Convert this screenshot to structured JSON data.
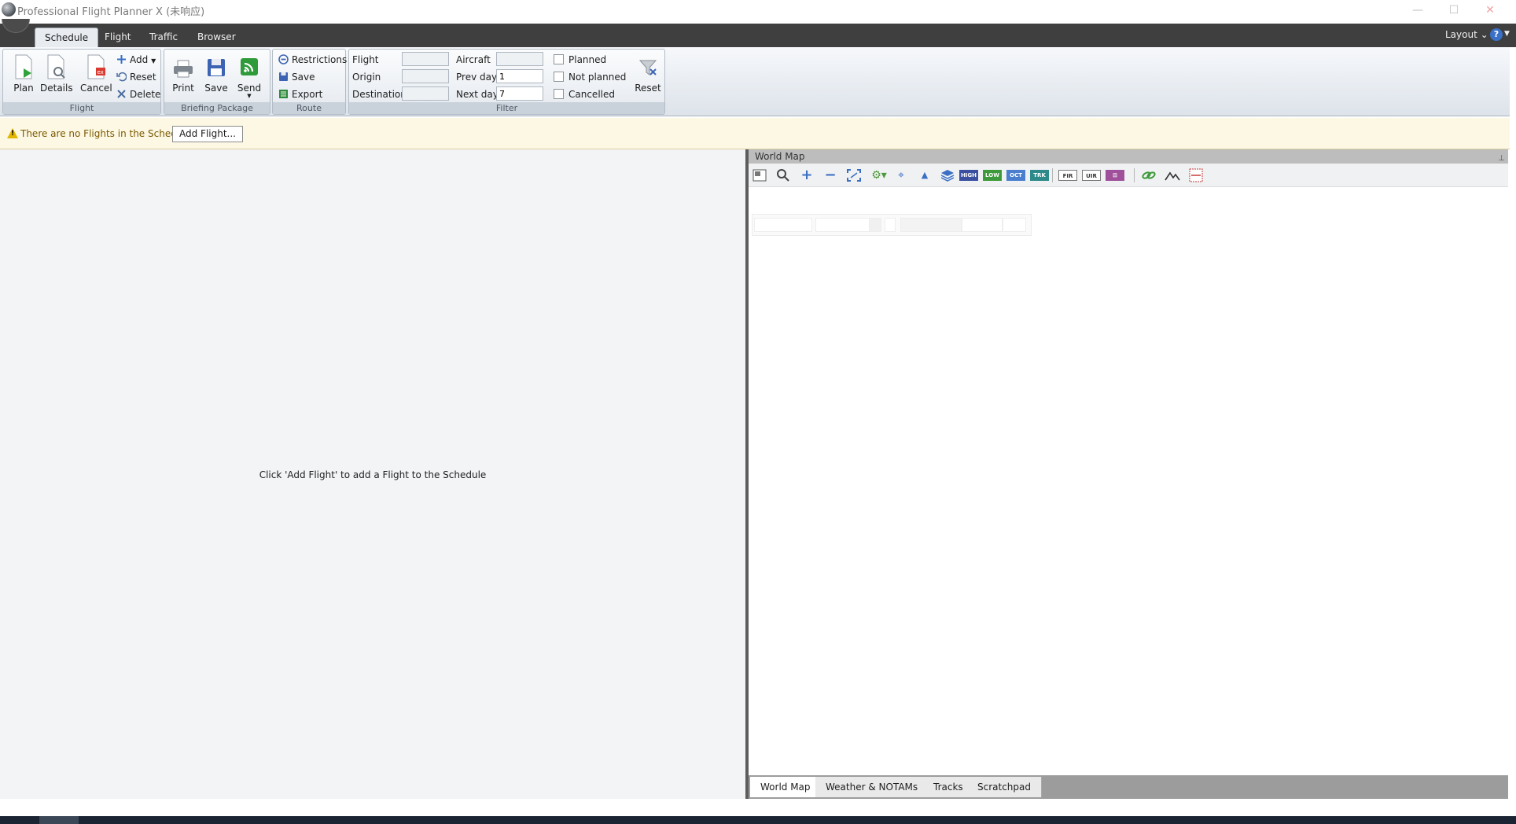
{
  "window": {
    "title": "Professional Flight Planner X (未响应)",
    "minimize": "—",
    "maximize": "☐",
    "close": "✕"
  },
  "ribbon_tabs": [
    "Schedule",
    "Flight",
    "Traffic",
    "Browser"
  ],
  "layout_menu": "Layout ⌄",
  "help": "?",
  "groups": {
    "flight": {
      "label": "Flight",
      "plan": "Plan",
      "details": "Details",
      "cancel": "Cancel",
      "add": "Add",
      "reset": "Reset",
      "delete": "Delete"
    },
    "briefing": {
      "label": "Briefing Package",
      "print": "Print",
      "save": "Save",
      "send": "Send"
    },
    "route": {
      "label": "Route",
      "restrictions": "Restrictions",
      "save": "Save",
      "export": "Export"
    },
    "filter": {
      "label": "Filter",
      "flight_label": "Flight",
      "flight_value": "",
      "origin_label": "Origin",
      "origin_value": "",
      "destination_label": "Destination",
      "destination_value": "",
      "aircraft_label": "Aircraft",
      "aircraft_value": "",
      "prev_days_label": "Prev days",
      "prev_days_value": "1",
      "next_days_label": "Next days",
      "next_days_value": "7",
      "planned": "Planned",
      "not_planned": "Not planned",
      "cancelled": "Cancelled",
      "reset": "Reset"
    }
  },
  "infobar": {
    "message": "There are no Flights in the Schedule",
    "button": "Add Flight..."
  },
  "schedule": {
    "empty_message": "Click 'Add Flight' to add a Flight to the Schedule"
  },
  "map": {
    "title": "World Map",
    "toolbar_tags": [
      "HIGH",
      "LOW",
      "OCT",
      "TRK",
      "FIR",
      "UIR"
    ],
    "bottom_tabs": [
      "World Map",
      "Weather & NOTAMs",
      "Tracks",
      "Scratchpad"
    ]
  },
  "colors": {
    "tab_bar": "#3f3f3f",
    "info_bg": "#fdf8e4",
    "info_text": "#7a5a00",
    "splitter": "#5d5d5d"
  }
}
